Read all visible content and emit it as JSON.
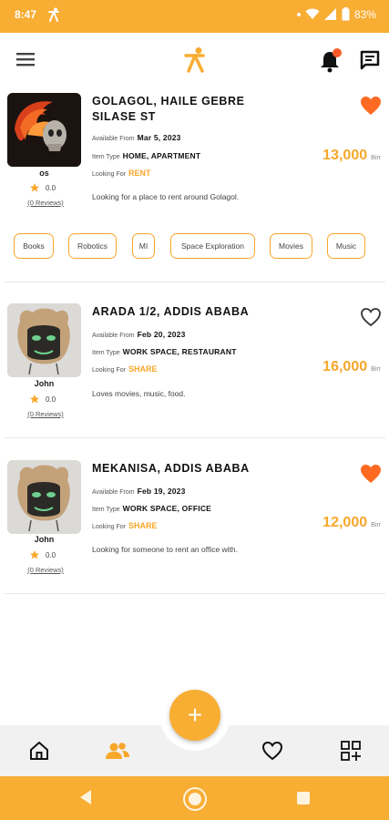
{
  "status_bar": {
    "time": "8:47",
    "battery": "83%"
  },
  "colors": {
    "accent": "#f8ad33",
    "heart": "#ff6a22",
    "text": "#111111"
  },
  "listings": [
    {
      "title": "GOLAGOL, HAILE GEBRE SILASE ST",
      "available_label": "Available From",
      "available_date": "Mar 5, 2023",
      "item_type_label": "Item Type",
      "item_type": "HOME, APARTMENT",
      "looking_for_label": "Looking For",
      "looking_for": "RENT",
      "description": "Looking for a place to rent around Golagol.",
      "price": "13,000",
      "currency": "Birr",
      "favorited": true,
      "user": {
        "name": "os",
        "rating": "0.0",
        "reviews": "(0 Reviews)"
      },
      "tags": [
        "Books",
        "Robotics",
        "MI",
        "Space Exploration",
        "Movies",
        "Music"
      ]
    },
    {
      "title": "ARADA 1/2, ADDIS ABABA",
      "available_label": "Available From",
      "available_date": "Feb 20, 2023",
      "item_type_label": "Item Type",
      "item_type": "WORK SPACE, RESTAURANT",
      "looking_for_label": "Looking For",
      "looking_for": "SHARE",
      "description": "Loves movies, music, food.",
      "price": "16,000",
      "currency": "Birr",
      "favorited": false,
      "user": {
        "name": "John",
        "rating": "0.0",
        "reviews": "(0 Reviews)"
      }
    },
    {
      "title": "MEKANISA, ADDIS ABABA",
      "available_label": "Available From",
      "available_date": "Feb 19, 2023",
      "item_type_label": "Item Type",
      "item_type": "WORK SPACE, OFFICE",
      "looking_for_label": "Looking For",
      "looking_for": "SHARE",
      "description": "Looking for someone to rent an office with.",
      "price": "12,000",
      "currency": "Birr",
      "favorited": true,
      "user": {
        "name": "John",
        "rating": "0.0",
        "reviews": "(0 Reviews)"
      }
    }
  ],
  "fab": {
    "label": "+"
  },
  "bottom_nav": {
    "items": [
      "home-icon",
      "people-icon",
      "heart-outline-icon",
      "grid-add-icon"
    ],
    "active_index": 1
  }
}
